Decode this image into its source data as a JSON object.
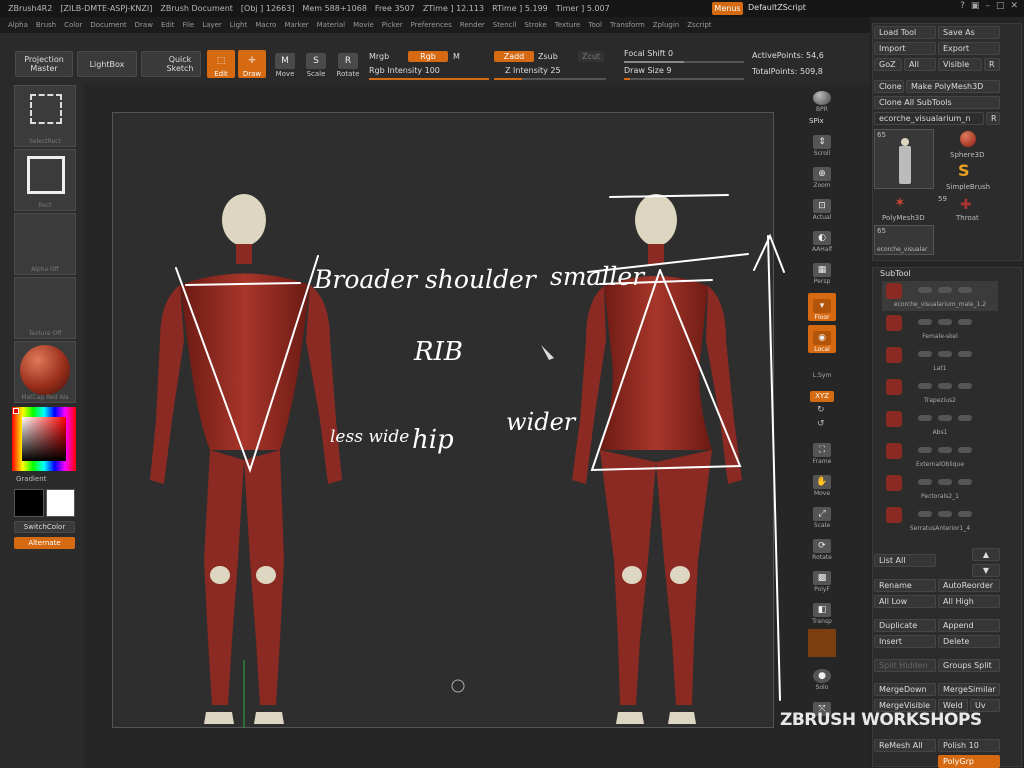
{
  "titlebar": {
    "app": "ZBrush4R2",
    "build": "[ZILB-DMTE-ASPJ-KNZI]",
    "document": "ZBrush Document",
    "obj": "[Obj ] 12663]",
    "mem": "Mem 588+1068",
    "free": "Free 3507",
    "ztime": "ZTime ] 12.113",
    "rtime": "RTime ] 5.199",
    "timer": "Timer ] 5.007",
    "menus_label": "Menus",
    "default_script": "DefaultZScript"
  },
  "menubar": [
    "Alpha",
    "Brush",
    "Color",
    "Document",
    "Draw",
    "Edit",
    "File",
    "Layer",
    "Light",
    "Macro",
    "Marker",
    "Material",
    "Movie",
    "Picker",
    "Preferences",
    "Render",
    "Stencil",
    "Stroke",
    "Texture",
    "Tool",
    "Transform",
    "Zplugin",
    "Zscript"
  ],
  "toolbar": {
    "projection_master": "Projection Master",
    "lightbox": "LightBox",
    "quick_sketch": "Quick Sketch",
    "edit": "Edit",
    "draw": "Draw",
    "move": "Move",
    "scale": "Scale",
    "rotate": "Rotate",
    "mrgb": "Mrgb",
    "rgb": "Rgb",
    "m": "M",
    "rgb_intensity_label": "Rgb Intensity",
    "rgb_intensity": "100",
    "zadd": "Zadd",
    "zsub": "Zsub",
    "zcut": "Zcut",
    "z_intensity_label": "Z Intensity",
    "z_intensity": "25",
    "focal_shift_label": "Focal Shift",
    "focal_shift": "0",
    "draw_size_label": "Draw Size",
    "draw_size": "9",
    "active_points": "ActivePoints: 54,6",
    "total_points": "TotalPoints: 509,8",
    "rgb_intensity_fraction": 1.0,
    "z_intensity_fraction": 0.25
  },
  "left_tray": {
    "select_rect": "SelectRect",
    "rect": "Rect",
    "alpha_off": "Alpha Off",
    "texture_off": "Texture Off",
    "matcap": "MatCap Red Wa",
    "gradient": "Gradient",
    "switch_color": "SwitchColor",
    "alternate": "Alternate"
  },
  "right_shelf": {
    "bpr": "BPR",
    "spix": "SPix",
    "scroll": "Scroll",
    "zoom": "Zoom",
    "actual": "Actual",
    "aahalf": "AAHalf",
    "persp": "Persp",
    "floor": "Floor",
    "local": "Local",
    "lsym": "L.Sym",
    "xyz": "XYZ",
    "frame": "Frame",
    "move": "Move",
    "scale": "Scale",
    "rotate": "Rotate",
    "polyf": "PolyF",
    "transp": "Transp",
    "solo": "Solo"
  },
  "right_panel": {
    "load_tool": "Load Tool",
    "save_as": "Save As",
    "import": "Import",
    "export": "Export",
    "goz": "GoZ",
    "all": "All",
    "visible": "Visible",
    "r": "R",
    "clone": "Clone",
    "make_polymesh": "Make PolyMesh3D",
    "clone_all_subtools": "Clone All SubTools",
    "current_tool": "ecorche_visualarium_n",
    "tool_count": "65",
    "tools": [
      {
        "name": "Sphere3D"
      },
      {
        "name": "SimpleBrush"
      },
      {
        "name": "PolyMesh3D"
      },
      {
        "name": "Throat",
        "count": "59"
      },
      {
        "name": "ecorche_visualar",
        "count": "65"
      }
    ],
    "subtool_header": "SubTool",
    "subtools": [
      "ecorche_visualarium_male_1.2",
      "Female-skel",
      "Lat1",
      "Trapezius2",
      "Abs1",
      "ExternalOblique",
      "Pectorals2_1",
      "SerratusAnterior1_4"
    ],
    "list_all": "List All",
    "rename": "Rename",
    "auto_reorder": "AutoReorder",
    "all_low": "All Low",
    "all_high": "All High",
    "duplicate": "Duplicate",
    "append": "Append",
    "insert": "Insert",
    "delete": "Delete",
    "split_hidden": "Split Hidden",
    "groups_split": "Groups Split",
    "merge_down": "MergeDown",
    "merge_similar": "MergeSimilar",
    "merge_visible": "MergeVisible",
    "weld": "Weld",
    "uv": "Uv",
    "remesh_all": "ReMesh All",
    "polish": "Polish 10",
    "polygrp": "PolyGrp"
  },
  "canvas": {
    "annotations": {
      "broader_shoulder": "Broader shoulder",
      "smaller": "smaller",
      "rib": "RIB",
      "less_wide": "less wide",
      "hip": "hip",
      "wider": "wider"
    }
  },
  "watermark": "ZBRUSH WORKSHOPS",
  "colors": {
    "accent": "#d66a12",
    "muscle": "#8a2a22",
    "bone": "#ddd6c0"
  }
}
